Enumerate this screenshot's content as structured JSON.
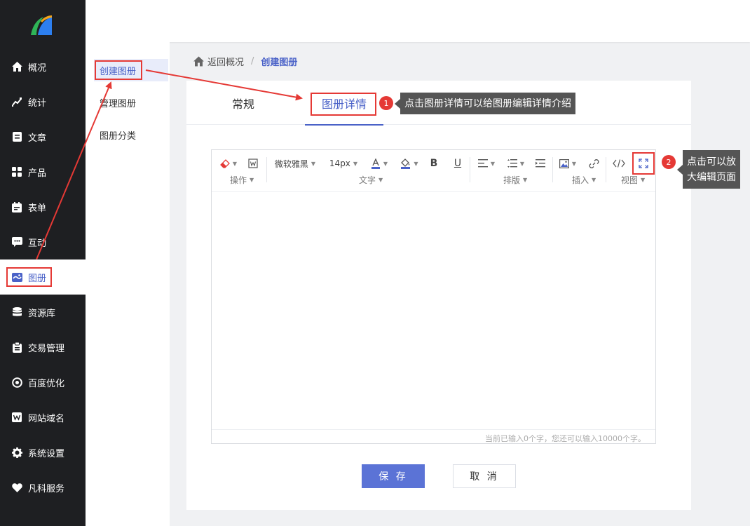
{
  "nav": {
    "items": [
      {
        "label": "概况",
        "icon": "home-icon"
      },
      {
        "label": "统计",
        "icon": "chart-icon"
      },
      {
        "label": "文章",
        "icon": "article-icon"
      },
      {
        "label": "产品",
        "icon": "grid-icon"
      },
      {
        "label": "表单",
        "icon": "calendar-icon"
      },
      {
        "label": "互动",
        "icon": "chat-icon"
      },
      {
        "label": "图册",
        "icon": "album-icon"
      },
      {
        "label": "资源库",
        "icon": "database-icon"
      },
      {
        "label": "交易管理",
        "icon": "clipboard-icon"
      },
      {
        "label": "百度优化",
        "icon": "target-icon"
      },
      {
        "label": "网站域名",
        "icon": "web-icon"
      },
      {
        "label": "系统设置",
        "icon": "gear-icon"
      },
      {
        "label": "凡科服务",
        "icon": "heart-icon"
      }
    ]
  },
  "submenu": {
    "items": [
      "创建图册",
      "管理图册",
      "图册分类"
    ]
  },
  "breadcrumb": {
    "back": "返回概况",
    "separator": "/",
    "current": "创建图册"
  },
  "tabs": [
    "常规",
    "图册详情"
  ],
  "toolbar": {
    "font_family": "微软雅黑",
    "font_size": "14px",
    "groups": [
      "操作",
      "文字",
      "排版",
      "插入",
      "视图"
    ]
  },
  "editor": {
    "footer": "当前已输入0个字，您还可以输入10000个字。"
  },
  "buttons": {
    "save": "保 存",
    "cancel": "取 消"
  },
  "annotations": {
    "badge1": "1",
    "tip1": "点击图册详情可以给图册编辑详情介绍",
    "badge2": "2",
    "tip2_line1": "点击可以放",
    "tip2_line2": "大编辑页面"
  },
  "colors": {
    "accent": "#4a62c8",
    "sidebar_bg": "#1e1f22",
    "highlight": "#e53935"
  }
}
